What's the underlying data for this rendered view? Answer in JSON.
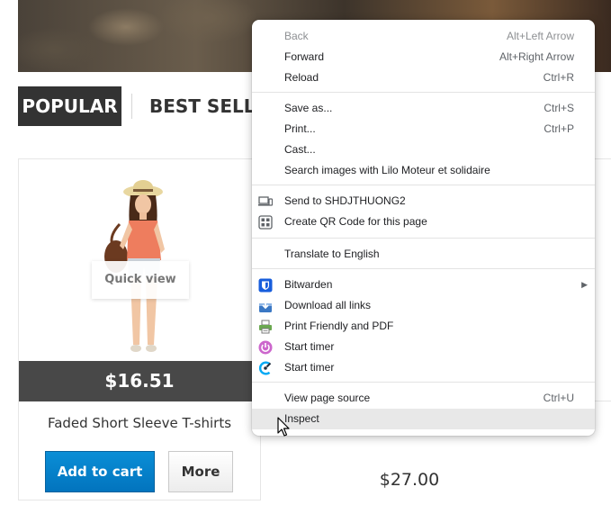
{
  "tabs": {
    "popular": "POPULAR",
    "best_sellers": "BEST SELLERS"
  },
  "product": {
    "quick_view": "Quick view",
    "price": "$16.51",
    "name": "Faded Short Sleeve T-shirts",
    "add_to_cart": "Add to cart",
    "more": "More"
  },
  "second_product": {
    "price": "$27.00"
  },
  "context_menu": {
    "items": [
      {
        "label": "Back",
        "shortcut": "Alt+Left Arrow",
        "disabled": true
      },
      {
        "label": "Forward",
        "shortcut": "Alt+Right Arrow"
      },
      {
        "label": "Reload",
        "shortcut": "Ctrl+R"
      },
      {
        "label": "Save as...",
        "shortcut": "Ctrl+S"
      },
      {
        "label": "Print...",
        "shortcut": "Ctrl+P"
      },
      {
        "label": "Cast..."
      },
      {
        "label": "Search images with Lilo Moteur et solidaire"
      },
      {
        "label": "Send to SHDJTHUONG2",
        "icon": "device-icon"
      },
      {
        "label": "Create QR Code for this page",
        "icon": "qr-code-icon"
      },
      {
        "label": "Translate to English"
      },
      {
        "label": "Bitwarden",
        "icon": "bitwarden-icon",
        "submenu": true
      },
      {
        "label": "Download all links",
        "icon": "download-links-icon"
      },
      {
        "label": "Print Friendly and PDF",
        "icon": "printer-icon"
      },
      {
        "label": "Start timer",
        "icon": "timer-power-icon"
      },
      {
        "label": "Start timer",
        "icon": "clockify-icon"
      },
      {
        "label": "View page source",
        "shortcut": "Ctrl+U"
      },
      {
        "label": "Inspect",
        "hover": true
      }
    ]
  },
  "colors": {
    "tab_active_bg": "#333333",
    "price_bar_bg": "#484848",
    "add_to_cart_bg": "#0274be",
    "bitwarden_blue": "#175ddc",
    "timer_purple": "#cc66cc",
    "clockify_blue": "#03a9f4"
  }
}
